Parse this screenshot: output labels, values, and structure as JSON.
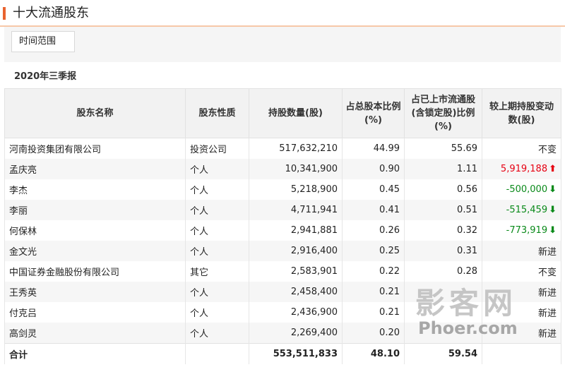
{
  "header": {
    "title": "十大流通股东"
  },
  "filter": {
    "range_button": "时间范围"
  },
  "report": {
    "period": "2020年三季报"
  },
  "table": {
    "columns": [
      "股东名称",
      "股东性质",
      "持股数量(股)",
      "占总股本比例(%)",
      "占已上市流通股(含锁定股)比例(%)",
      "较上期持股变动数(股)"
    ],
    "rows": [
      {
        "name": "河南投资集团有限公司",
        "type": "投资公司",
        "shares": "517,632,210",
        "total_pct": "44.99",
        "float_pct": "55.69",
        "change": "不变",
        "trend": "none"
      },
      {
        "name": "孟庆亮",
        "type": "个人",
        "shares": "10,341,900",
        "total_pct": "0.90",
        "float_pct": "1.11",
        "change": "5,919,188",
        "trend": "up"
      },
      {
        "name": "李杰",
        "type": "个人",
        "shares": "5,218,900",
        "total_pct": "0.45",
        "float_pct": "0.56",
        "change": "-500,000",
        "trend": "down"
      },
      {
        "name": "李丽",
        "type": "个人",
        "shares": "4,711,941",
        "total_pct": "0.41",
        "float_pct": "0.51",
        "change": "-515,459",
        "trend": "down"
      },
      {
        "name": "何保林",
        "type": "个人",
        "shares": "2,941,881",
        "total_pct": "0.26",
        "float_pct": "0.32",
        "change": "-773,919",
        "trend": "down"
      },
      {
        "name": "金文光",
        "type": "个人",
        "shares": "2,916,400",
        "total_pct": "0.25",
        "float_pct": "0.31",
        "change": "新进",
        "trend": "none"
      },
      {
        "name": "中国证券金融股份有限公司",
        "type": "其它",
        "shares": "2,583,901",
        "total_pct": "0.22",
        "float_pct": "0.28",
        "change": "不变",
        "trend": "none"
      },
      {
        "name": "王秀英",
        "type": "个人",
        "shares": "2,458,400",
        "total_pct": "0.21",
        "float_pct": "",
        "change": "新进",
        "trend": "none"
      },
      {
        "name": "付克吕",
        "type": "个人",
        "shares": "2,436,900",
        "total_pct": "0.21",
        "float_pct": "",
        "change": "新进",
        "trend": "none"
      },
      {
        "name": "高剑灵",
        "type": "个人",
        "shares": "2,269,400",
        "total_pct": "0.20",
        "float_pct": "",
        "change": "新进",
        "trend": "none"
      }
    ],
    "total": {
      "label": "合计",
      "shares": "553,511,833",
      "total_pct": "48.10",
      "float_pct": "59.54"
    }
  },
  "watermark": {
    "cn": "影客网",
    "en": "Phoer.com"
  },
  "colors": {
    "accent": "#e9632f",
    "up": "#e60012",
    "down": "#0a8a1a"
  }
}
